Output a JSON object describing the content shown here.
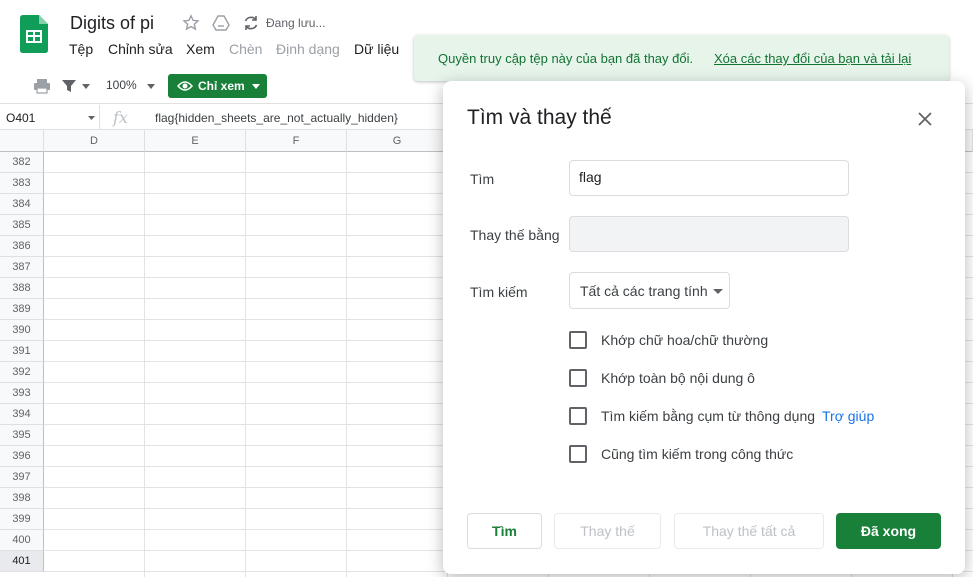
{
  "doc": {
    "title": "Digits of pi",
    "saving_status": "Đang lưu..."
  },
  "menu": {
    "items": [
      "Tệp",
      "Chỉnh sửa",
      "Xem",
      "Chèn",
      "Định dạng",
      "Dữ liệu"
    ]
  },
  "toolbar": {
    "zoom": "100%",
    "view_only_label": "Chỉ xem"
  },
  "formula_bar": {
    "cell_ref": "O401",
    "formula": "flag{hidden_sheets_are_not_actually_hidden}"
  },
  "grid": {
    "columns": [
      "D",
      "E",
      "F",
      "G"
    ],
    "rows": [
      "382",
      "383",
      "384",
      "385",
      "386",
      "387",
      "388",
      "389",
      "390",
      "391",
      "392",
      "393",
      "394",
      "395",
      "396",
      "397",
      "398",
      "399",
      "400",
      "401"
    ],
    "selected_row": "401"
  },
  "toast": {
    "message": "Quyền truy cập tệp này của bạn đã thay đổi.",
    "link": "Xóa các thay đổi của bạn và tải lại"
  },
  "dialog": {
    "title": "Tìm và thay thế",
    "find_label": "Tìm",
    "find_value": "flag",
    "replace_label": "Thay thế bằng",
    "replace_value": "",
    "search_label": "Tìm kiếm",
    "search_scope": "Tất cả các trang tính",
    "checkboxes": [
      {
        "label": "Khớp chữ hoa/chữ thường",
        "checked": false
      },
      {
        "label": "Khớp toàn bộ nội dung ô",
        "checked": false
      },
      {
        "label": "Tìm kiếm bằng cụm từ thông dụng",
        "checked": false
      },
      {
        "label": "Cũng tìm kiếm trong công thức",
        "checked": false
      }
    ],
    "help_link": "Trợ giúp",
    "buttons": {
      "find": "Tìm",
      "replace": "Thay thế",
      "replace_all": "Thay thế tất cả",
      "done": "Đã xong"
    }
  },
  "colors": {
    "accent_green": "#188038",
    "toast_bg": "#e6f4ea",
    "link_blue": "#1a73e8"
  }
}
